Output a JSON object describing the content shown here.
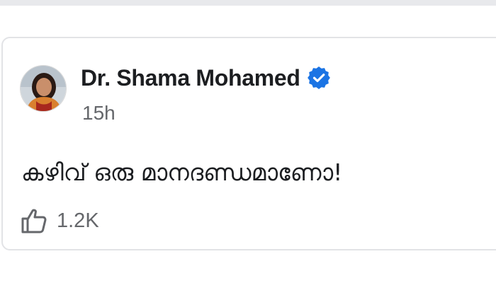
{
  "post": {
    "author": "Dr. Shama Mohamed",
    "timestamp": "15h",
    "text": "കഴിവ് ഒരു മാനദണ്ഡമാണോ!",
    "likes": "1.2K",
    "verified": true
  },
  "icons": {
    "verified": "verified-badge-icon",
    "like": "thumbs-up-icon"
  },
  "colors": {
    "verified_badge": "#1b74e4",
    "text_primary": "#1c1e21",
    "text_secondary": "#65676b",
    "card_border": "#e2e3e6"
  }
}
